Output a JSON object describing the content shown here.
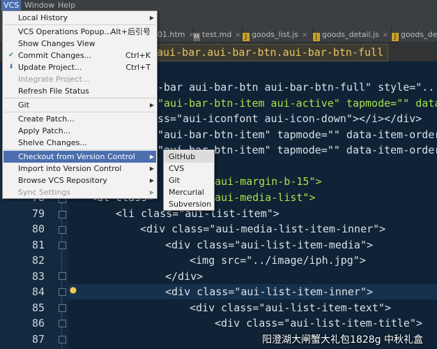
{
  "menubar": {
    "items": [
      {
        "label": "VCS",
        "active": true
      },
      {
        "label": "Window",
        "active": false
      },
      {
        "label": "Help",
        "active": false
      }
    ]
  },
  "tabs": [
    {
      "label": "01.htm"
    },
    {
      "label": "test.md"
    },
    {
      "label": "goods_list.js"
    },
    {
      "label": "goods_detail.js"
    },
    {
      "label": "goods_det"
    }
  ],
  "breadcrumb": "aui-bar.aui-bar-btn.aui-bar-btn-full",
  "vcs_menu": {
    "items": [
      {
        "label": "Local History"
      },
      {
        "label": "VCS Operations Popup...",
        "shortcut": "Alt+后引号"
      },
      {
        "label": "Show Changes View"
      },
      {
        "label": "Commit Changes...",
        "shortcut": "Ctrl+K"
      },
      {
        "label": "Update Project...",
        "shortcut": "Ctrl+T"
      },
      {
        "label": "Integrate Project..."
      },
      {
        "label": "Refresh File Status"
      },
      {
        "label": "Git"
      },
      {
        "label": "Create Patch..."
      },
      {
        "label": "Apply Patch..."
      },
      {
        "label": "Shelve Changes..."
      },
      {
        "label": "Checkout from Version Control"
      },
      {
        "label": "Import into Version Control"
      },
      {
        "label": "Browse VCS Repository"
      },
      {
        "label": "Sync Settings"
      }
    ]
  },
  "checkout_submenu": {
    "items": [
      {
        "label": "GitHub"
      },
      {
        "label": "CVS"
      },
      {
        "label": "Git"
      },
      {
        "label": "Mercurial"
      },
      {
        "label": "Subversion"
      }
    ]
  },
  "editor": {
    "line_numbers": [
      "78",
      "79",
      "80",
      "81",
      "82",
      "83",
      "84",
      "85",
      "86",
      "87"
    ],
    "code": {
      "l0_text": "-bar aui-bar-btn aui-bar-btn-full\" style=\"...",
      "l1_text": "\"aui-bar-btn-item aui-active\" tapmode=\"\" data",
      "l2_text": "ss=\"aui-iconfont aui-icon-down\"></i></div>",
      "l3_text": "\"aui-bar-btn-item\" tapmode=\"\" data-item-order",
      "l4_text": "\"aui-bar-btn-item\" tapmode=\"\" data-item-order",
      "l6_text": "aui-margin-b-15\">",
      "l7_pre": "<ul class=",
      "l7_text": "aui-media-list\">",
      "l8_text": "<li class=\"aui-list-item\">",
      "l9_text": "<div class=\"aui-media-list-item-inner\">",
      "l10_text": "<div class=\"aui-list-item-media\">",
      "l11_text": "<img src=\"../image/iph.jpg\">",
      "l12_text": "</div>",
      "l13_text": "<div class=\"aui-list-item-inner\">",
      "l14_text": "<div class=\"aui-list-item-text\">",
      "l15_text": "<div class=\"aui-list-item-title\">"
    }
  },
  "overlay_text": "阳澄湖大闸蟹大礼包1828g 中秋礼盒",
  "colors": {
    "editor_bg": "#0f2236",
    "menu_bg": "#f2f2f2",
    "menu_highlight": "#4b6eaf",
    "string": "#a7e34b",
    "breadcrumb_text": "#e8c46a"
  }
}
